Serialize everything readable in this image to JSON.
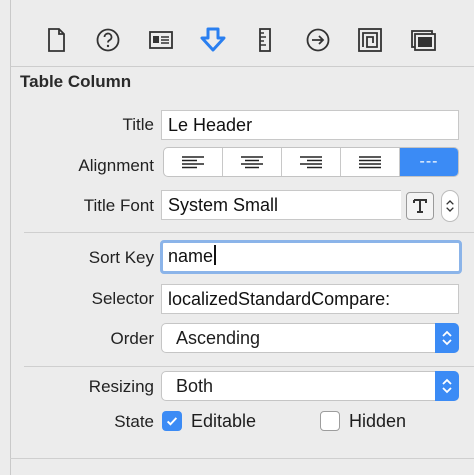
{
  "toolbar": {
    "icons": [
      "file-icon",
      "help-icon",
      "identity-icon",
      "attributes-icon",
      "ruler-icon",
      "connections-icon",
      "bindings-icon",
      "effects-icon"
    ]
  },
  "section": {
    "title": "Table Column"
  },
  "title_row": {
    "label": "Title",
    "value": "Le Header"
  },
  "alignment_row": {
    "label": "Alignment",
    "options": [
      "left",
      "center",
      "right",
      "justified",
      "natural"
    ],
    "selected": "natural",
    "selected_glyph": "---"
  },
  "font_row": {
    "label": "Title Font",
    "value": "System Small"
  },
  "sort_key_row": {
    "label": "Sort Key",
    "value": "name"
  },
  "selector_row": {
    "label": "Selector",
    "value": "localizedStandardCompare:"
  },
  "order_row": {
    "label": "Order",
    "value": "Ascending"
  },
  "resizing_row": {
    "label": "Resizing",
    "value": "Both"
  },
  "state_row": {
    "label": "State",
    "editable": {
      "label": "Editable",
      "checked": true
    },
    "hidden": {
      "label": "Hidden",
      "checked": false
    }
  },
  "colors": {
    "accent": "#3b8bf5",
    "focus_ring": "#8bb4e9",
    "background": "#ececec"
  }
}
